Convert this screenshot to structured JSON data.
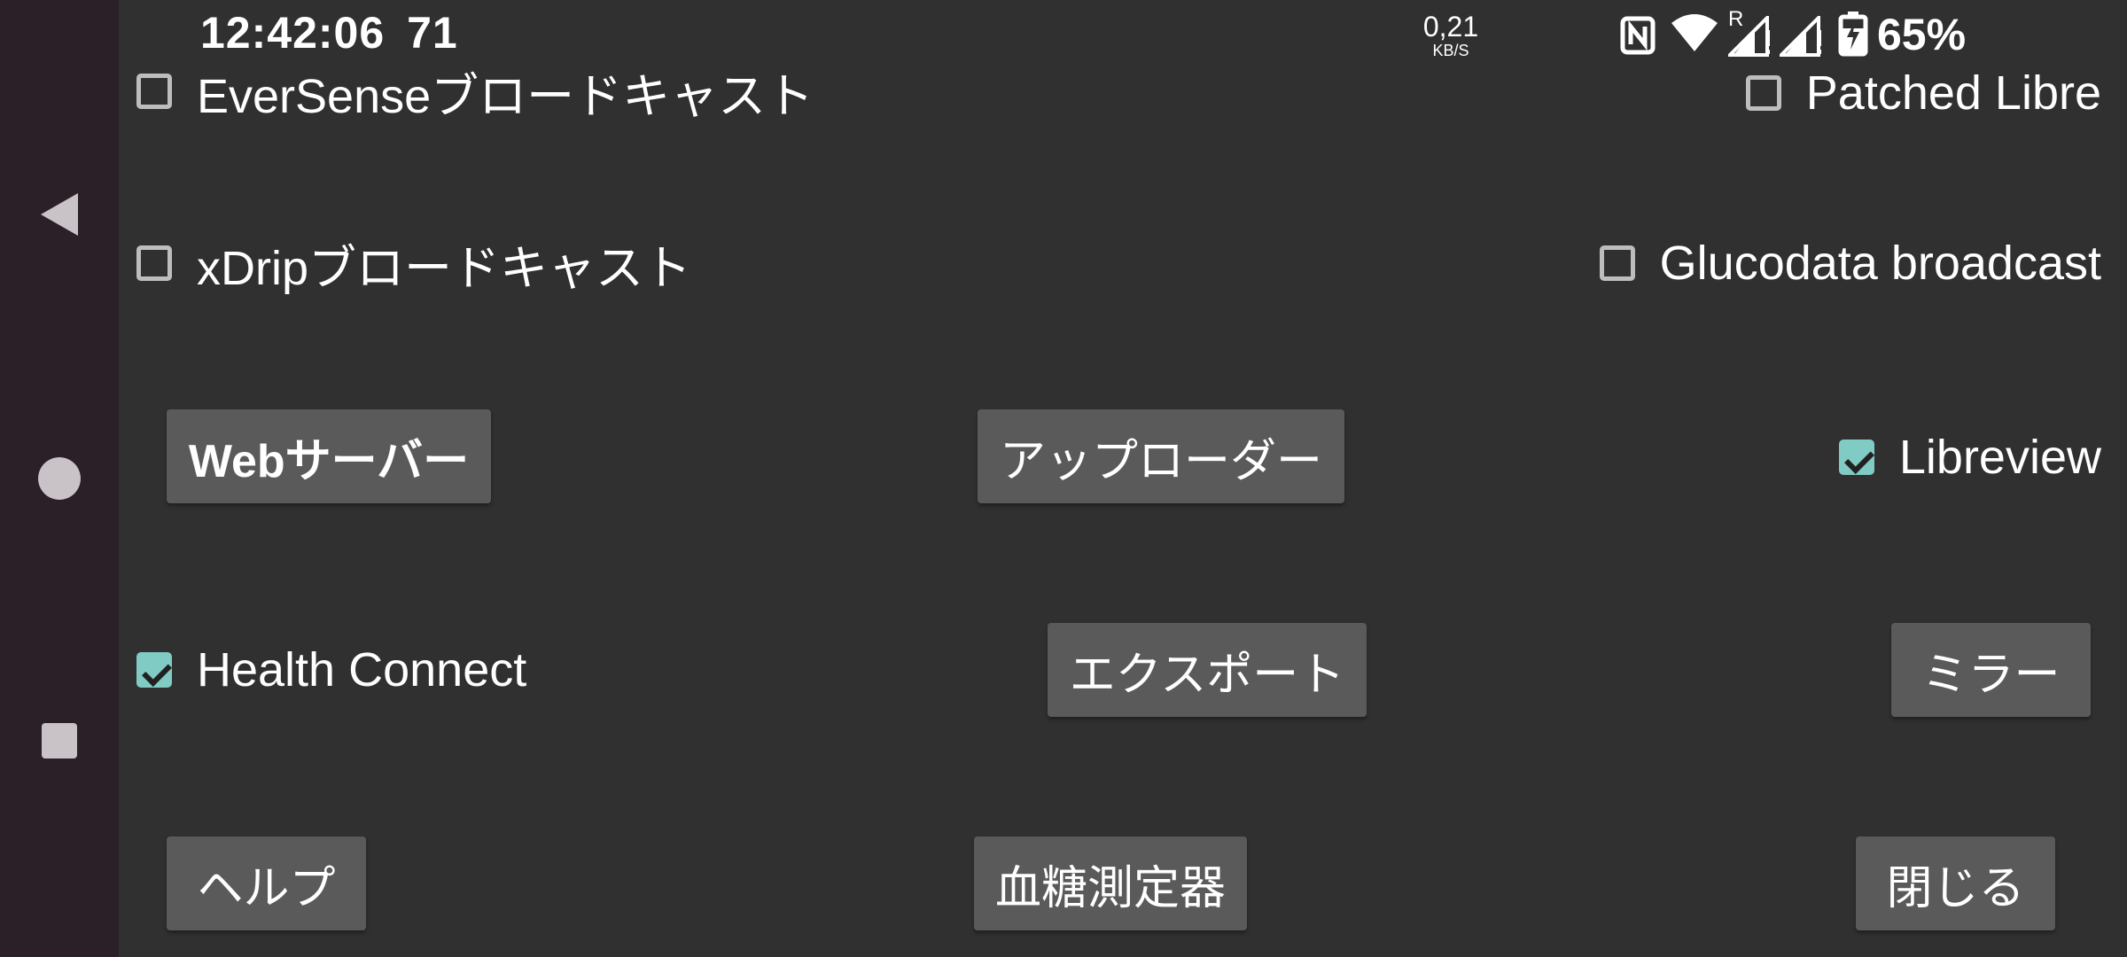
{
  "status_bar": {
    "time": "12:42:06",
    "notification_count": "71",
    "net_speed_value": "0,21",
    "net_speed_unit": "KB/S",
    "roaming_indicator": "R",
    "battery_percent": "65%",
    "icons": [
      "nfc-icon",
      "wifi-icon",
      "signal-roaming-icon",
      "signal-icon",
      "battery-charging-icon"
    ]
  },
  "navigation": {
    "items": [
      "back-icon",
      "home-icon",
      "recents-icon"
    ]
  },
  "options": {
    "eversense_broadcast": {
      "label": "EverSenseブロードキャスト",
      "checked": false
    },
    "patched_libre": {
      "label": "Patched Libre",
      "checked": false
    },
    "xdrip_broadcast": {
      "label": "xDripブロードキャスト",
      "checked": false
    },
    "glucodata_broadcast": {
      "label": "Glucodata broadcast",
      "checked": false
    },
    "libreview": {
      "label": "Libreview",
      "checked": true
    },
    "health_connect": {
      "label": "Health Connect",
      "checked": true
    }
  },
  "buttons": {
    "web_server": "Webサーバー",
    "uploader": "アップローダー",
    "export": "エクスポート",
    "mirror": "ミラー",
    "help": "ヘルプ",
    "glucose_meter": "血糖測定器",
    "close": "閉じる"
  },
  "colors": {
    "background": "#303030",
    "nav_bar": "#2b1f28",
    "button": "#5a5a5a",
    "checkbox_checked": "#80cbc4"
  }
}
